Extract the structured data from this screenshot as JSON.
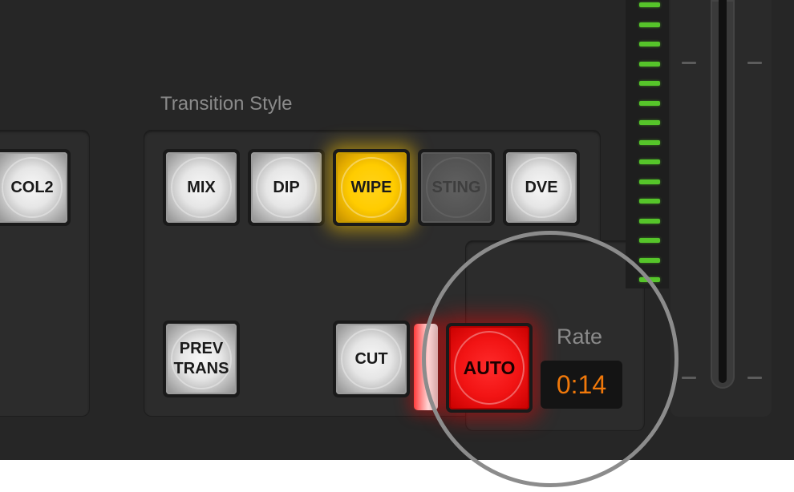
{
  "transition": {
    "title": "Transition Style",
    "styles": [
      {
        "id": "mix",
        "label": "MIX",
        "state": "off"
      },
      {
        "id": "dip",
        "label": "DIP",
        "state": "off"
      },
      {
        "id": "wipe",
        "label": "WIPE",
        "state": "selected"
      },
      {
        "id": "sting",
        "label": "STING",
        "state": "disabled"
      },
      {
        "id": "dve",
        "label": "DVE",
        "state": "off"
      }
    ],
    "prev_trans": {
      "line1": "PREV",
      "line2": "TRANS"
    },
    "cut": {
      "label": "CUT"
    },
    "auto": {
      "label": "AUTO",
      "state": "active"
    },
    "rate": {
      "label": "Rate",
      "value": "0:14"
    }
  },
  "left_group": {
    "col2": {
      "label": "COL2"
    }
  },
  "colors": {
    "selected": "#ffcc00",
    "active": "#f21414",
    "rate_value": "#f0780a",
    "meter": "#56c52a"
  }
}
